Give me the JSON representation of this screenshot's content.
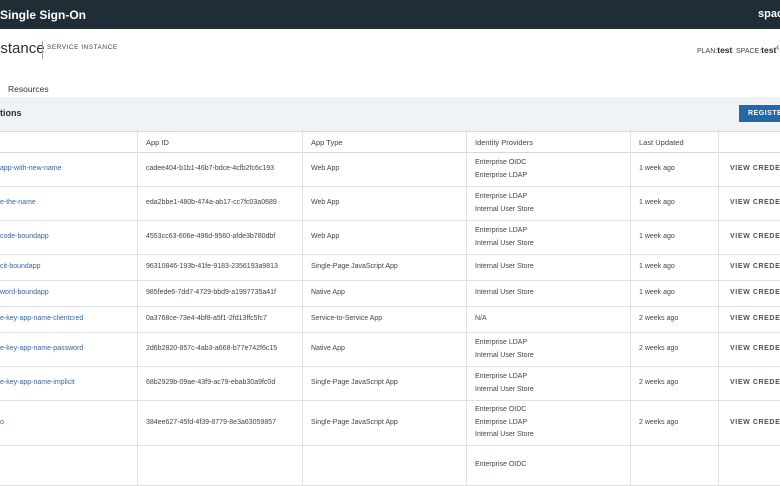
{
  "topbar": {
    "title": "Single Sign-On",
    "space_name": "space"
  },
  "instance": {
    "name": "nstance",
    "type": "SERVICE INSTANCE",
    "plan_label": "PLAN:",
    "plan_value": "test",
    "space_label": "SPACE:",
    "space_value": "test",
    "more": "‹"
  },
  "tabs": {
    "resources": "Resources"
  },
  "section": {
    "title": "tions",
    "register_label": "REGISTER"
  },
  "table": {
    "columns": [
      "",
      "App ID",
      "App Type",
      "Identity Providers",
      "Last Updated",
      ""
    ],
    "rows": [
      {
        "name": "app-with-new-name",
        "id": "cadee404-b1b1-46b7-bdce-4cfb2fc6c193",
        "type": "Web App",
        "providers": [
          "Enterprise OIDC",
          "Enterprise LDAP"
        ],
        "updated": "1 week ago",
        "action": "VIEW CREDENT"
      },
      {
        "name": "e-the-name",
        "id": "eda2bbe1-480b-474a-ab17-cc7fc03a0689",
        "type": "Web App",
        "providers": [
          "Enterprise LDAP",
          "Internal User Store"
        ],
        "updated": "1 week ago",
        "action": "VIEW CREDENT"
      },
      {
        "name": "code-boundapp",
        "id": "4553cc63-606e-496d-9560-afde3b780dbf",
        "type": "Web App",
        "providers": [
          "Enterprise LDAP",
          "Internal User Store"
        ],
        "updated": "1 week ago",
        "action": "VIEW CREDENT"
      },
      {
        "name": "cit-boundapp",
        "id": "96310846-193b-41fe-9183-2356193a9813",
        "type": "Single-Page JavaScript App",
        "providers": [
          "Internal User Store"
        ],
        "updated": "1 week ago",
        "action": "VIEW CREDENT"
      },
      {
        "name": "word-boundapp",
        "id": "985fede6-7dd7-4729-bbd9-a1997735a41f",
        "type": "Native App",
        "providers": [
          "Internal User Store"
        ],
        "updated": "1 week ago",
        "action": "VIEW CREDENT"
      },
      {
        "name": "e-key-app-name-clientcred",
        "id": "0a3768ce-73e4-4bf8-a5f1-2fd13ffc5fc7",
        "type": "Service-to-Service App",
        "providers": [
          "N/A"
        ],
        "updated": "2 weeks ago",
        "action": "VIEW CREDENT"
      },
      {
        "name": "e-key-app-name-password",
        "id": "2d6b2820-857c-4ab3-a668-b77e742f6c15",
        "type": "Native App",
        "providers": [
          "Enterprise LDAP",
          "Internal User Store"
        ],
        "updated": "2 weeks ago",
        "action": "VIEW CREDENT"
      },
      {
        "name": "e-key-app-name-implicit",
        "id": "68b2929b-09ae-43f9-ac79-ebab30a9fc0d",
        "type": "Single-Page JavaScript App",
        "providers": [
          "Enterprise LDAP",
          "Internal User Store"
        ],
        "updated": "2 weeks ago",
        "action": "VIEW CREDENT"
      },
      {
        "name": "o",
        "id": "384ee627-45fd-4f39-8779-8e3a63059857",
        "type": "Single-Page JavaScript App",
        "providers": [
          "Enterprise OIDC",
          "Enterprise LDAP",
          "Internal User Store"
        ],
        "updated": "2 weeks ago",
        "action": "VIEW CREDENT"
      },
      {
        "name": "",
        "id": "",
        "type": "",
        "providers": [
          "Enterprise OIDC"
        ],
        "updated": "",
        "action": ""
      }
    ]
  }
}
